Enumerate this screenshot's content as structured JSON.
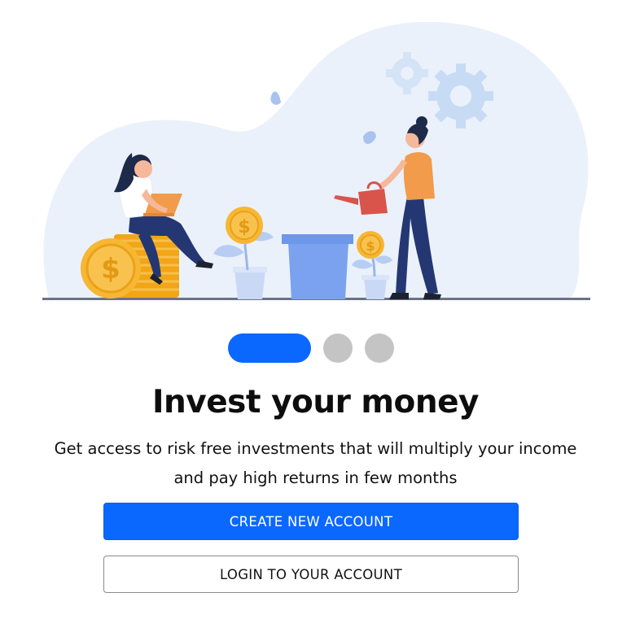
{
  "onboarding": {
    "illustration_name": "investment-growth-illustration",
    "pager": {
      "total_pages": 3,
      "active_index": 0,
      "active_color": "#0a68ff",
      "inactive_color": "#c4c4c4"
    },
    "title": "Invest your money",
    "subtitle": "Get access to risk free investments that will multiply your income and pay high returns in few months",
    "create_account_label": "CREATE NEW ACCOUNT",
    "login_label": "LOGIN TO YOUR ACCOUNT"
  },
  "colors": {
    "brand_blue": "#0a68ff",
    "background_blob": "#eaf1fa",
    "coin_gold": "#f7b733",
    "plant_leaf": "#b7cdf3"
  }
}
